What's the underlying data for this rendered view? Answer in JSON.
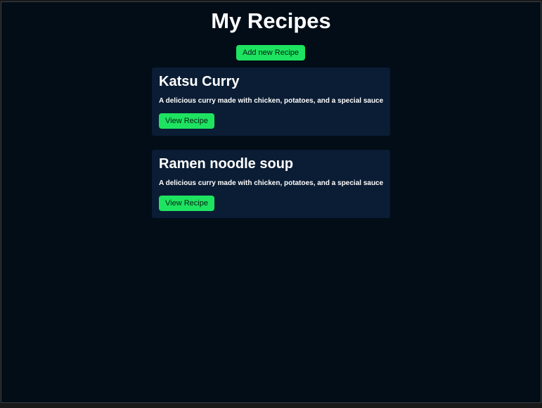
{
  "page": {
    "title": "My Recipes",
    "add_button_label": "Add new Recipe"
  },
  "recipes": [
    {
      "title": "Katsu Curry",
      "description": "A delicious curry made with chicken, potatoes, and a special sauce",
      "view_button_label": "View Recipe"
    },
    {
      "title": "Ramen noodle soup",
      "description": "A delicious curry made with chicken, potatoes, and a special sauce",
      "view_button_label": "View Recipe"
    }
  ],
  "colors": {
    "background": "#020d18",
    "card": "#0b1d34",
    "accent": "#1ee360",
    "text": "#ffffff"
  }
}
